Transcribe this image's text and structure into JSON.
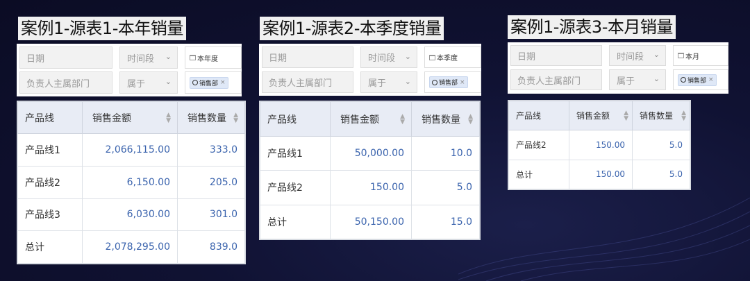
{
  "panels": [
    {
      "title": "案例1-源表1-本年销量",
      "filters": {
        "date_label": "日期",
        "date_op": "时间段",
        "date_value": "本年度",
        "dept_label": "负责人主属部门",
        "dept_op": "属于",
        "dept_tag": "销售部"
      },
      "columns": [
        "产品线",
        "销售金额",
        "销售数量"
      ],
      "rows": [
        [
          "产品线1",
          "2,066,115.00",
          "333.0"
        ],
        [
          "产品线2",
          "6,150.00",
          "205.0"
        ],
        [
          "产品线3",
          "6,030.00",
          "301.0"
        ],
        [
          "总计",
          "2,078,295.00",
          "839.0"
        ]
      ]
    },
    {
      "title": "案例1-源表2-本季度销量",
      "filters": {
        "date_label": "日期",
        "date_op": "时间段",
        "date_value": "本季度",
        "dept_label": "负责人主属部门",
        "dept_op": "属于",
        "dept_tag": "销售部"
      },
      "columns": [
        "产品线",
        "销售金额",
        "销售数量"
      ],
      "rows": [
        [
          "产品线1",
          "50,000.00",
          "10.0"
        ],
        [
          "产品线2",
          "150.00",
          "5.0"
        ],
        [
          "总计",
          "50,150.00",
          "15.0"
        ]
      ]
    },
    {
      "title": "案例1-源表3-本月销量",
      "filters": {
        "date_label": "日期",
        "date_op": "时间段",
        "date_value": "本月",
        "dept_label": "负责人主属部门",
        "dept_op": "属于",
        "dept_tag": "销售部"
      },
      "columns": [
        "产品线",
        "销售金额",
        "销售数量"
      ],
      "rows": [
        [
          "产品线2",
          "150.00",
          "5.0"
        ],
        [
          "总计",
          "150.00",
          "5.0"
        ]
      ]
    }
  ],
  "icons": {
    "sort": "sort-icon",
    "chevron": "chevron-down-icon",
    "calendar": "calendar-icon",
    "radio": "circle-icon",
    "remove": "close-icon"
  },
  "colors": {
    "background": "#0f1130",
    "header_bg": "#e8ecf5",
    "number_text": "#3a63ad",
    "tag_bg": "#dfe8f7"
  }
}
